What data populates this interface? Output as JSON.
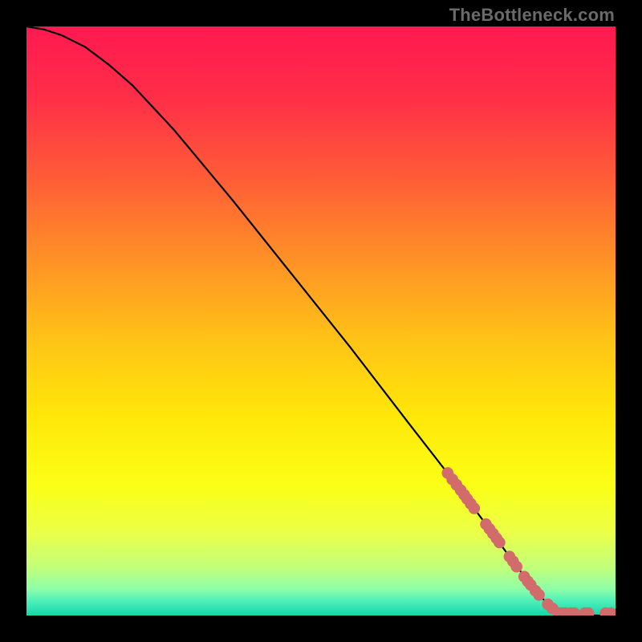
{
  "watermark": "TheBottleneck.com",
  "chart_data": {
    "type": "line",
    "title": "",
    "xlabel": "",
    "ylabel": "",
    "xlim": [
      0,
      100
    ],
    "ylim": [
      0,
      100
    ],
    "curve": [
      {
        "x": 0,
        "y": 100.0
      },
      {
        "x": 3,
        "y": 99.5
      },
      {
        "x": 6,
        "y": 98.5
      },
      {
        "x": 10,
        "y": 96.5
      },
      {
        "x": 14,
        "y": 93.5
      },
      {
        "x": 18,
        "y": 90.0
      },
      {
        "x": 25,
        "y": 82.5
      },
      {
        "x": 35,
        "y": 70.5
      },
      {
        "x": 45,
        "y": 58.0
      },
      {
        "x": 55,
        "y": 45.5
      },
      {
        "x": 65,
        "y": 32.5
      },
      {
        "x": 72,
        "y": 23.5
      },
      {
        "x": 78,
        "y": 15.5
      },
      {
        "x": 82,
        "y": 10.0
      },
      {
        "x": 85,
        "y": 6.0
      },
      {
        "x": 87.5,
        "y": 3.0
      },
      {
        "x": 89,
        "y": 1.5
      },
      {
        "x": 90.5,
        "y": 0.6
      },
      {
        "x": 92,
        "y": 0.2
      },
      {
        "x": 94,
        "y": 0.05
      },
      {
        "x": 97,
        "y": 0.0
      },
      {
        "x": 100,
        "y": 0.0
      }
    ],
    "marker_color": "#d26b6b",
    "markers": [
      {
        "x": 71.5,
        "y": 24.2
      },
      {
        "x": 72.3,
        "y": 23.1
      },
      {
        "x": 73.0,
        "y": 22.2
      },
      {
        "x": 73.7,
        "y": 21.3
      },
      {
        "x": 74.3,
        "y": 20.5
      },
      {
        "x": 74.8,
        "y": 19.8
      },
      {
        "x": 75.4,
        "y": 19.0
      },
      {
        "x": 76.0,
        "y": 18.2
      },
      {
        "x": 78.0,
        "y": 15.5
      },
      {
        "x": 78.6,
        "y": 14.7
      },
      {
        "x": 79.2,
        "y": 13.9
      },
      {
        "x": 79.8,
        "y": 13.1
      },
      {
        "x": 80.3,
        "y": 12.4
      },
      {
        "x": 82.0,
        "y": 10.0
      },
      {
        "x": 82.6,
        "y": 9.2
      },
      {
        "x": 83.2,
        "y": 8.3
      },
      {
        "x": 84.5,
        "y": 6.6
      },
      {
        "x": 85.1,
        "y": 5.8
      },
      {
        "x": 85.6,
        "y": 5.2
      },
      {
        "x": 86.4,
        "y": 4.2
      },
      {
        "x": 87.0,
        "y": 3.5
      },
      {
        "x": 88.5,
        "y": 1.9
      },
      {
        "x": 89.3,
        "y": 1.2
      },
      {
        "x": 90.3,
        "y": 0.4
      },
      {
        "x": 90.9,
        "y": 0.4
      },
      {
        "x": 91.5,
        "y": 0.4
      },
      {
        "x": 92.4,
        "y": 0.4
      },
      {
        "x": 93.0,
        "y": 0.4
      },
      {
        "x": 94.8,
        "y": 0.4
      },
      {
        "x": 95.4,
        "y": 0.4
      },
      {
        "x": 98.3,
        "y": 0.4
      },
      {
        "x": 99.2,
        "y": 0.4
      }
    ],
    "gradient_stops": [
      {
        "pos": 0.0,
        "color": "#ff1950"
      },
      {
        "pos": 0.12,
        "color": "#ff2e48"
      },
      {
        "pos": 0.25,
        "color": "#ff5a38"
      },
      {
        "pos": 0.38,
        "color": "#ff8b28"
      },
      {
        "pos": 0.52,
        "color": "#ffbf18"
      },
      {
        "pos": 0.66,
        "color": "#ffe708"
      },
      {
        "pos": 0.78,
        "color": "#fbff16"
      },
      {
        "pos": 0.86,
        "color": "#eaff48"
      },
      {
        "pos": 0.92,
        "color": "#c0ff7c"
      },
      {
        "pos": 0.955,
        "color": "#8effa8"
      },
      {
        "pos": 0.975,
        "color": "#4ef0b8"
      },
      {
        "pos": 0.99,
        "color": "#2de0b0"
      },
      {
        "pos": 1.0,
        "color": "#18d4a2"
      }
    ]
  }
}
